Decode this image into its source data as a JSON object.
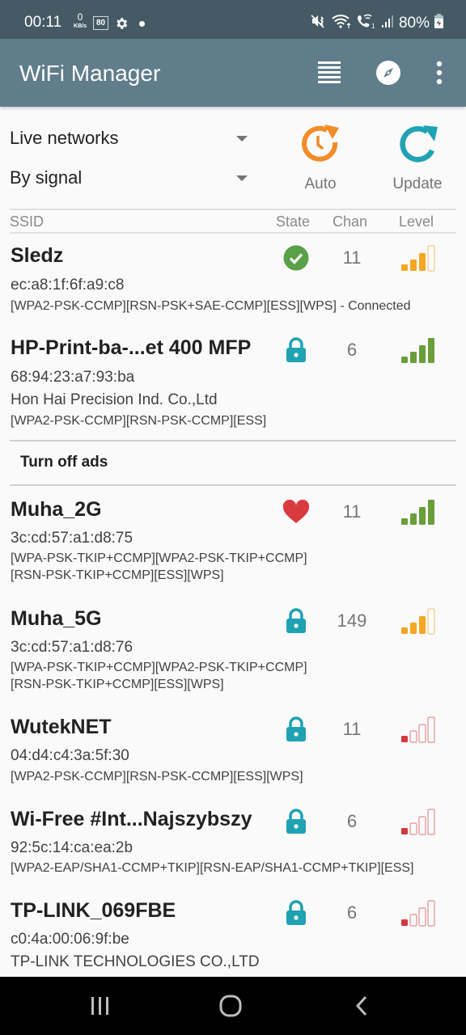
{
  "status_bar": {
    "time": "00:11",
    "net_speed_value": "0",
    "net_speed_unit": "KB/s",
    "badge": "80",
    "battery": "80%"
  },
  "app_bar": {
    "title": "WiFi Manager",
    "icons": [
      "list-view-icon",
      "compass-icon",
      "more-vert-icon"
    ]
  },
  "controls": {
    "filter_dropdown": "Live networks",
    "sort_dropdown": "By signal",
    "auto_label": "Auto",
    "update_label": "Update",
    "auto_color": "#f28c28",
    "update_color": "#1fa2b2"
  },
  "table_header": {
    "ssid": "SSID",
    "state": "State",
    "chan": "Chan",
    "level": "Level"
  },
  "ads_banner": {
    "label": "Turn off ads"
  },
  "networks": [
    {
      "ssid": "Sledz",
      "mac": "ec:a8:1f:6f:a9:c8",
      "vendor": "",
      "caps": [
        "[WPA2-PSK-CCMP][RSN-PSK+SAE-CCMP][ESS][WPS] - Connected"
      ],
      "state": "connected",
      "chan": "11",
      "level_bars": 3,
      "level_color": "#f5a623"
    },
    {
      "ssid": "HP-Print-ba-...et 400 MFP",
      "mac": "68:94:23:a7:93:ba",
      "vendor": "Hon Hai Precision Ind. Co.,Ltd",
      "caps": [
        "[WPA2-PSK-CCMP][RSN-PSK-CCMP][ESS]"
      ],
      "state": "locked",
      "chan": "6",
      "level_bars": 4,
      "level_color": "#6a9e3a"
    },
    {
      "ssid": "Muha_2G",
      "mac": "3c:cd:57:a1:d8:75",
      "vendor": "",
      "caps": [
        "[WPA-PSK-TKIP+CCMP][WPA2-PSK-TKIP+CCMP]",
        "[RSN-PSK-TKIP+CCMP][ESS][WPS]"
      ],
      "state": "favorite",
      "chan": "11",
      "level_bars": 4,
      "level_color": "#6a9e3a"
    },
    {
      "ssid": "Muha_5G",
      "mac": "3c:cd:57:a1:d8:76",
      "vendor": "",
      "caps": [
        "[WPA-PSK-TKIP+CCMP][WPA2-PSK-TKIP+CCMP]",
        "[RSN-PSK-TKIP+CCMP][ESS][WPS]"
      ],
      "state": "locked",
      "chan": "149",
      "level_bars": 3,
      "level_color": "#f5a623"
    },
    {
      "ssid": "WutekNET",
      "mac": "04:d4:c4:3a:5f:30",
      "vendor": "",
      "caps": [
        "[WPA2-PSK-CCMP][RSN-PSK-CCMP][ESS][WPS]"
      ],
      "state": "locked",
      "chan": "11",
      "level_bars": 1,
      "level_color": "#d2393f"
    },
    {
      "ssid": "Wi-Free #Int...Najszybszy",
      "mac": "92:5c:14:ca:ea:2b",
      "vendor": "",
      "caps": [
        "[WPA2-EAP/SHA1-CCMP+TKIP][RSN-EAP/SHA1-CCMP+TKIP][ESS]"
      ],
      "state": "locked",
      "chan": "6",
      "level_bars": 1,
      "level_color": "#d2393f"
    },
    {
      "ssid": "TP-LINK_069FBE",
      "mac": "c0:4a:00:06:9f:be",
      "vendor": "TP-LINK TECHNOLOGIES CO.,LTD",
      "caps": [],
      "state": "locked",
      "chan": "6",
      "level_bars": 1,
      "level_color": "#d2393f"
    }
  ],
  "nav_bar": {
    "icons": [
      "recent-apps-icon",
      "home-icon",
      "back-icon"
    ]
  }
}
